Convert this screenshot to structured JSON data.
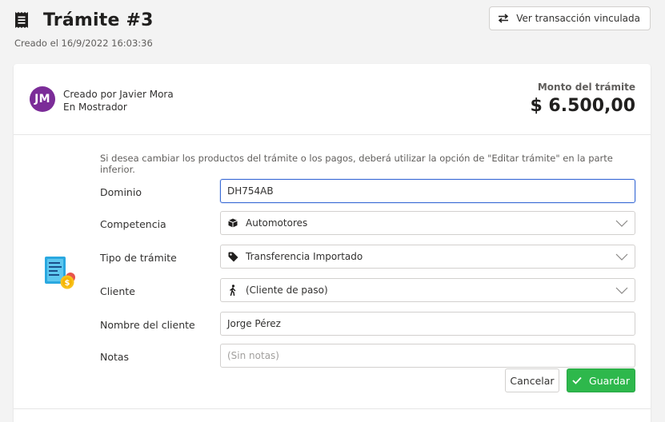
{
  "header": {
    "title": "Trámite #3",
    "created": "Creado el 16/9/2022 16:03:36",
    "linked_button_label": "Ver transacción vinculada"
  },
  "creator": {
    "initials": "JM",
    "avatar_color": "#7b2c98",
    "created_by": "Creado por Javier Mora",
    "location": "En Mostrador"
  },
  "amount": {
    "label": "Monto del trámite",
    "value": "$ 6.500,00"
  },
  "form": {
    "notice": "Si desea cambiar los productos del trámite o los pagos, deberá utilizar la opción de \"Editar trámite\" en la parte inferior.",
    "dominio": {
      "label": "Dominio",
      "value": "DH754AB"
    },
    "competencia": {
      "label": "Competencia",
      "value": "Automotores",
      "icon": "box-icon"
    },
    "tipo": {
      "label": "Tipo de trámite",
      "value": "Transferencia Importado",
      "icon": "tag-icon"
    },
    "cliente": {
      "label": "Cliente",
      "value": "(Cliente de paso)",
      "icon": "walking-person-icon"
    },
    "nombre": {
      "label": "Nombre del cliente",
      "value": "Jorge Pérez"
    },
    "notas": {
      "label": "Notas",
      "placeholder": "(Sin notas)"
    }
  },
  "actions": {
    "cancel_label": "Cancelar",
    "save_label": "Guardar",
    "save_color": "#2eb84c"
  }
}
